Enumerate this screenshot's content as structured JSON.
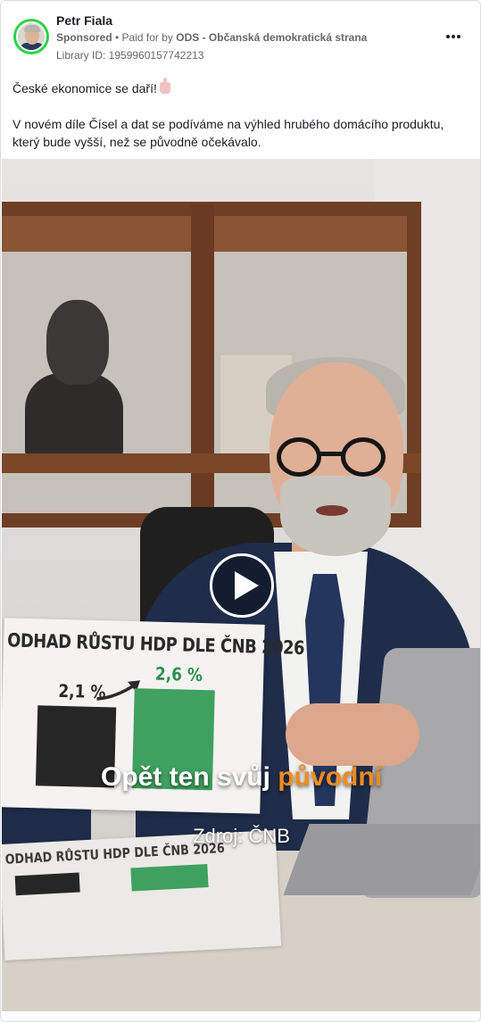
{
  "post": {
    "author": "Petr Fiala",
    "sponsored_label": "Sponsored",
    "paid_prefix": " • Paid for by ",
    "payer": "ODS - Občanská demokratická strana",
    "library_id": "Library ID: 1959960157742213",
    "more_icon": "more-horizontal-icon",
    "avatar_ring_color": "#2fd14b",
    "text_line1": "České ekonomice se daří!",
    "text_paragraph2": "V novém díle Čísel a dat se podíváme na výhled hrubého domácího produktu, který bude vyšší, než se původně očekávalo."
  },
  "video": {
    "chart_title": "ODHAD RŮSTU HDP DLE ČNB 2026",
    "value_before": "2,1 %",
    "value_after": "2,6 %",
    "paper2_title": "ODHAD RŮSTU HDP DLE ČNB 2026",
    "caption_plain": "Opět ten svůj ",
    "caption_highlight": "původní",
    "source": "Zdroj: ČNB",
    "play_icon": "play-icon",
    "accent_green": "#3fa05f",
    "accent_orange": "#f28c1e"
  }
}
